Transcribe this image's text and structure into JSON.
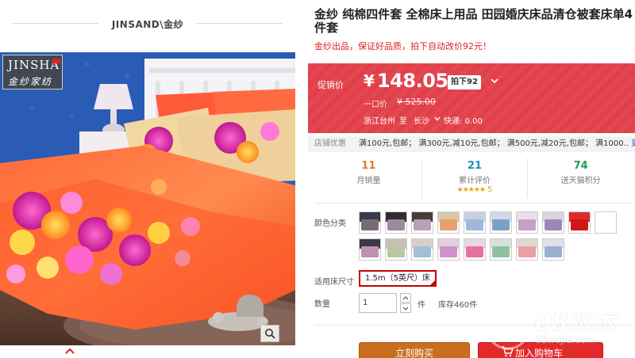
{
  "gallery": {
    "brand_title": "JINSAND\\金纱",
    "logo_main": "JINSHA",
    "logo_sub": "金纱家纺"
  },
  "product": {
    "title": "金纱 纯棉四件套 全棉床上用品 田园婚庆床品清仓被套床单4件套",
    "subtitle": "金纱出品，保证好品质，拍下自动改价92元！"
  },
  "price": {
    "label": "促销价",
    "currency": "¥",
    "value": "148.05",
    "coupon": "拍下92",
    "original_label": "一口价",
    "original_price": "¥ 525.00"
  },
  "shipping": {
    "from": "浙江台州",
    "to_label": "至",
    "to": "长沙",
    "fee": "快递: 0.00"
  },
  "shop_promo": {
    "label": "店铺优惠",
    "items": "满100元,包邮；  满300元,减10元,包邮；  满500元,减20元,包邮；  满1000..",
    "more": "更多"
  },
  "stats": [
    {
      "value": "11",
      "label": "月销量",
      "color": "#e07a2e"
    },
    {
      "value": "21",
      "label": "累计评价",
      "color": "#1f8fb5",
      "stars": "★★★★★",
      "rating": "5"
    },
    {
      "value": "74",
      "label": "送天猫积分",
      "color": "#1f9c55"
    }
  ],
  "sku": {
    "color_label": "颜色分类",
    "swatch_colors": [
      {
        "wall": "#3a3a4a",
        "bed": "#7a6a78"
      },
      {
        "wall": "#2e2e2e",
        "bed": "#9a8aa0"
      },
      {
        "wall": "#4a3a3a",
        "bed": "#b8a0b8"
      },
      {
        "wall": "#d8c8a8",
        "bed": "#e8a070"
      },
      {
        "wall": "#c8d0e0",
        "bed": "#a0b8d8"
      },
      {
        "wall": "#d0d8e8",
        "bed": "#7aa0c8"
      },
      {
        "wall": "#e8e0e8",
        "bed": "#c8a0c0"
      },
      {
        "wall": "#dcd4e0",
        "bed": "#9a88b8"
      },
      {
        "wall": "#e02a2a",
        "bed": "#d01818"
      },
      {
        "wall": "#ffffff",
        "bed": "#ffffff"
      },
      {
        "wall": "#3a3a4a",
        "bed": "#c090b0"
      },
      {
        "wall": "#c8c0b0",
        "bed": "#b8c8a0"
      },
      {
        "wall": "#d8d0c8",
        "bed": "#a0c0d8"
      },
      {
        "wall": "#e0d0e0",
        "bed": "#d090c8"
      },
      {
        "wall": "#e8d8e0",
        "bed": "#e870a0"
      },
      {
        "wall": "#d8e0d8",
        "bed": "#90c0a0"
      },
      {
        "wall": "#e0d8d0",
        "bed": "#e8a0a0"
      },
      {
        "wall": "#e0e0e8",
        "bed": "#9ab0d0"
      }
    ],
    "size_label": "适用床尺寸",
    "size_value": "1.5m（5英尺）床"
  },
  "quantity": {
    "label": "数量",
    "value": "1",
    "unit": "件",
    "stock": "库存460件"
  },
  "actions": {
    "buy": "立刻购买",
    "cart": "加入购物车"
  },
  "watermark": {
    "text": "08水木",
    "sub": "08wojia.com"
  }
}
